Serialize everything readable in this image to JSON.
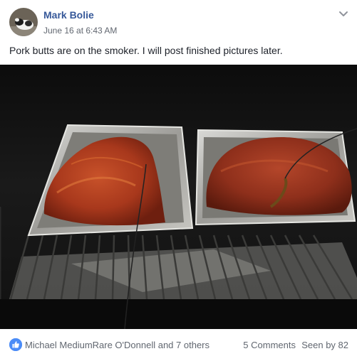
{
  "post": {
    "author": "Mark Bolie",
    "timestamp": "June 16 at 6:43 AM",
    "text": "Pork butts are on the smoker. I will post finished pictures later.",
    "photo_icon": "photo-of-two-pans-of-pork-on-smoker-grill"
  },
  "icons": {
    "avatar": "avatar-dog-photo",
    "menu": "chevron-down-icon",
    "reaction": "like-thumbs-up-icon"
  },
  "footer": {
    "reactions_text": "Michael MediumRare O'Donnell and 7 others",
    "comments_text": "5 Comments",
    "seen_text": "Seen by 82"
  },
  "colors": {
    "author": "#365899",
    "meta": "#616770",
    "like_blue": "#4b8cf7"
  }
}
